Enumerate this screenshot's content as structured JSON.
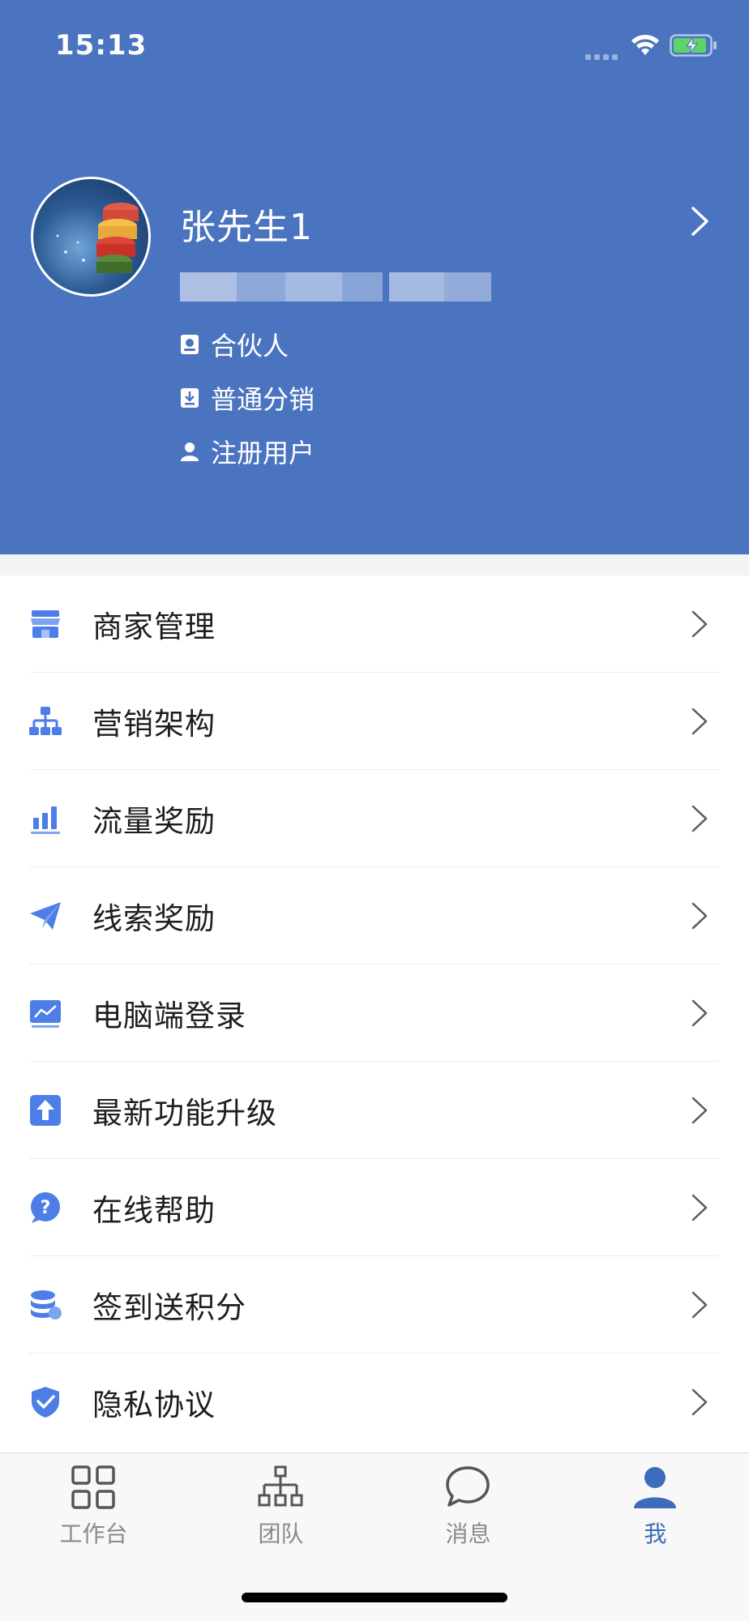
{
  "status_bar": {
    "time": "15:13"
  },
  "profile": {
    "name": "张先生1",
    "badges": [
      {
        "icon": "id-card-icon",
        "label": "合伙人"
      },
      {
        "icon": "download-doc-icon",
        "label": "普通分销"
      },
      {
        "icon": "user-icon",
        "label": "注册用户"
      }
    ]
  },
  "menu": {
    "items": [
      {
        "icon": "store-icon",
        "label": "商家管理"
      },
      {
        "icon": "org-chart-icon",
        "label": "营销架构"
      },
      {
        "icon": "bar-chart-icon",
        "label": "流量奖励"
      },
      {
        "icon": "paper-plane-icon",
        "label": "线索奖励"
      },
      {
        "icon": "monitor-icon",
        "label": "电脑端登录"
      },
      {
        "icon": "upgrade-icon",
        "label": "最新功能升级"
      },
      {
        "icon": "help-icon",
        "label": "在线帮助"
      },
      {
        "icon": "coins-icon",
        "label": "签到送积分"
      },
      {
        "icon": "shield-check-icon",
        "label": "隐私协议"
      }
    ]
  },
  "tabbar": {
    "tabs": [
      {
        "icon": "grid-icon",
        "label": "工作台",
        "active": false
      },
      {
        "icon": "team-icon",
        "label": "团队",
        "active": false
      },
      {
        "icon": "chat-bubble-icon",
        "label": "消息",
        "active": false
      },
      {
        "icon": "person-icon",
        "label": "我",
        "active": true
      }
    ]
  },
  "colors": {
    "header": "#4a74c0",
    "accent": "#3d6cbc",
    "icon": "#4d7ee8"
  }
}
